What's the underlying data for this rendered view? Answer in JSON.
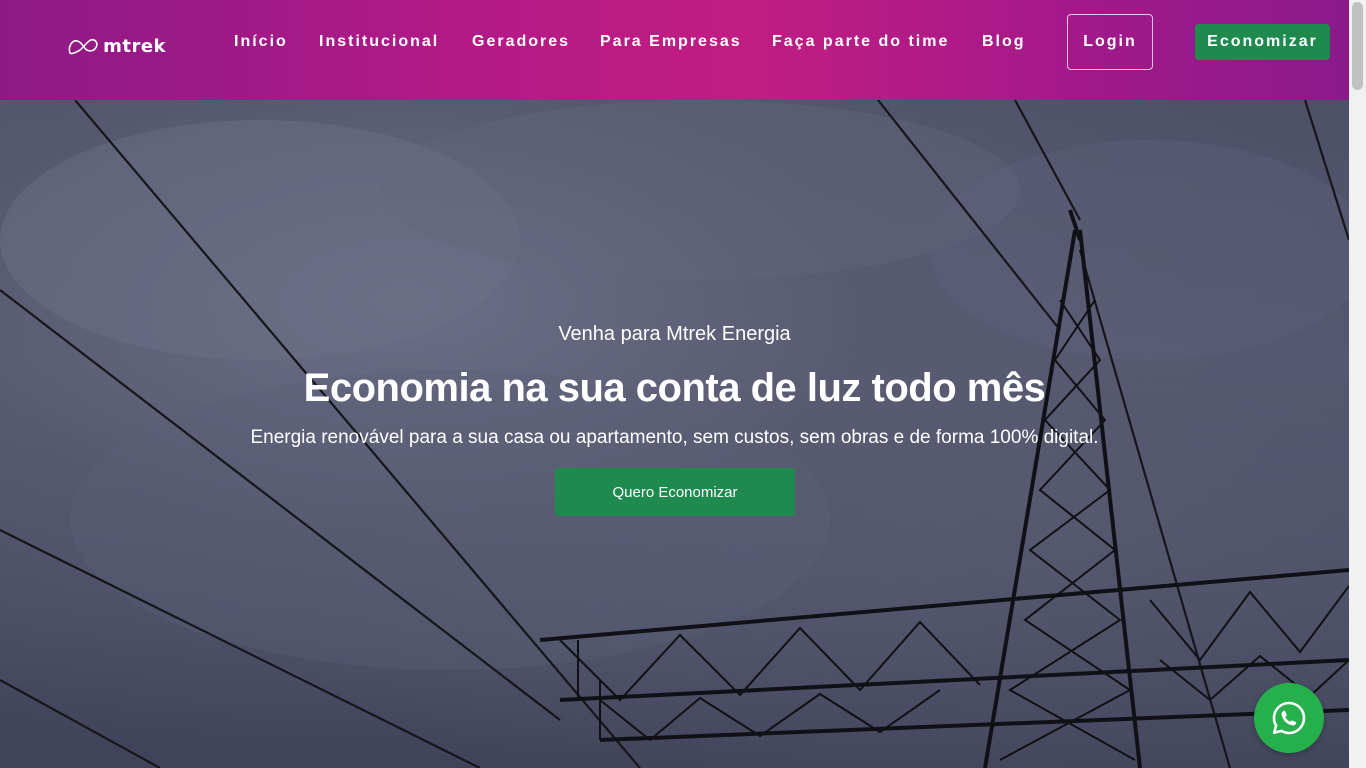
{
  "header": {
    "logo_text": "mtrek",
    "logo_icon": "mtrek-logo-icon",
    "nav": [
      {
        "label": "Início"
      },
      {
        "label": "Institucional"
      },
      {
        "label": "Geradores"
      },
      {
        "label": "Para Empresas"
      },
      {
        "label": "Faça parte do time"
      },
      {
        "label": "Blog"
      }
    ],
    "login_label": "Login",
    "economizar_label": "Economizar"
  },
  "hero": {
    "kicker": "Venha para Mtrek Energia",
    "headline": "Economia na sua conta de luz todo mês",
    "subline": "Energia renovável para a sua casa ou apartamento, sem custos, sem obras e de forma 100% digital.",
    "cta_label": "Quero Economizar",
    "background": "power-transmission-tower-photo"
  },
  "floating": {
    "whatsapp_icon": "whatsapp-icon"
  },
  "colors": {
    "header_gradient": [
      "#8c1a85",
      "#c11d82"
    ],
    "button_green": "#1f8a4e",
    "whatsapp_green": "#25b04b"
  }
}
